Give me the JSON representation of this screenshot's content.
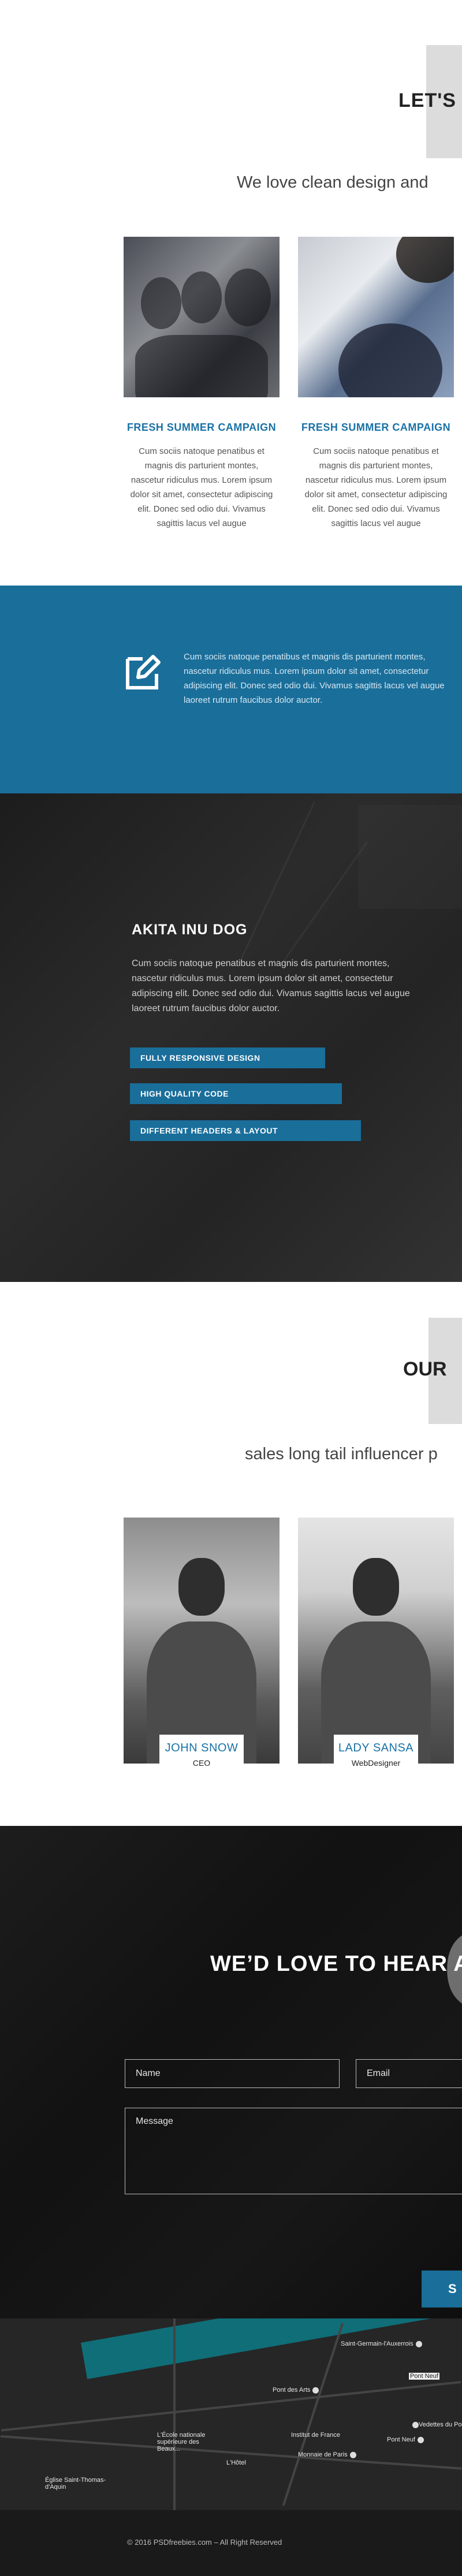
{
  "intro": {
    "heading": "LET'S",
    "subheading": "We love clean design and"
  },
  "portfolio": [
    {
      "title": "FRESH SUMMER CAMPAIGN",
      "text": "Cum sociis natoque penatibus et magnis dis parturient montes, nascetur ridiculus mus. Lorem ipsum dolor sit amet, consectetur adipiscing elit. Donec sed odio dui. Vivamus sagittis lacus vel augue"
    },
    {
      "title": "FRESH SUMMER CAMPAIGN",
      "text": "Cum sociis natoque penatibus et magnis dis parturient montes, nascetur ridiculus mus. Lorem ipsum dolor sit amet, consectetur adipiscing elit. Donec sed odio dui. Vivamus sagittis lacus vel augue"
    }
  ],
  "feature_band": {
    "icon": "edit-icon",
    "text": "Cum sociis natoque penatibus et magnis dis parturient montes, nascetur ridiculus mus. Lorem ipsum dolor sit amet, consectetur adipiscing elit. Donec sed odio dui. Vivamus sagittis lacus vel augue laoreet rutrum faucibus dolor auctor."
  },
  "about": {
    "heading": "AKITA INU DOG",
    "text": "Cum sociis natoque penatibus et magnis dis parturient montes, nascetur ridiculus mus. Lorem ipsum dolor sit amet, consectetur adipiscing elit. Donec sed odio dui. Vivamus sagittis lacus vel augue laoreet rutrum faucibus dolor auctor.",
    "skills": [
      {
        "label": "FULLY RESPONSIVE DESIGN",
        "level": 0.72
      },
      {
        "label": "HIGH QUALITY CODE",
        "level": 0.78
      },
      {
        "label": "DIFFERENT HEADERS & LAYOUT",
        "level": 0.85
      }
    ]
  },
  "team": {
    "heading": "OUR",
    "subheading": "sales long tail influencer p",
    "members": [
      {
        "name": "JOHN SNOW",
        "role": "CEO"
      },
      {
        "name": "LADY SANSA",
        "role": "WebDesigner"
      }
    ]
  },
  "contact": {
    "heading": "WE’D LOVE TO HEAR A",
    "name_placeholder": "Name",
    "email_placeholder": "Email",
    "message_placeholder": "Message",
    "send_label": "S"
  },
  "map": {
    "labels": [
      "Saint-Germain-l'Auxerrois",
      "Pont des Arts",
      "Pont Neuf",
      "L'École nationale supérieure des Beaux...",
      "Institut de France",
      "Vedettes du Pont",
      "Pont Neuf",
      "L'Hôtel",
      "Monnaie de Paris",
      "Église Saint-Thomas-d'Aquin"
    ]
  },
  "footer": {
    "copyright": "© 2016 PSDfreebies.com – All Right Reserved"
  },
  "colors": {
    "accent": "#1a6e9a",
    "title_blue": "#1a72a6"
  }
}
